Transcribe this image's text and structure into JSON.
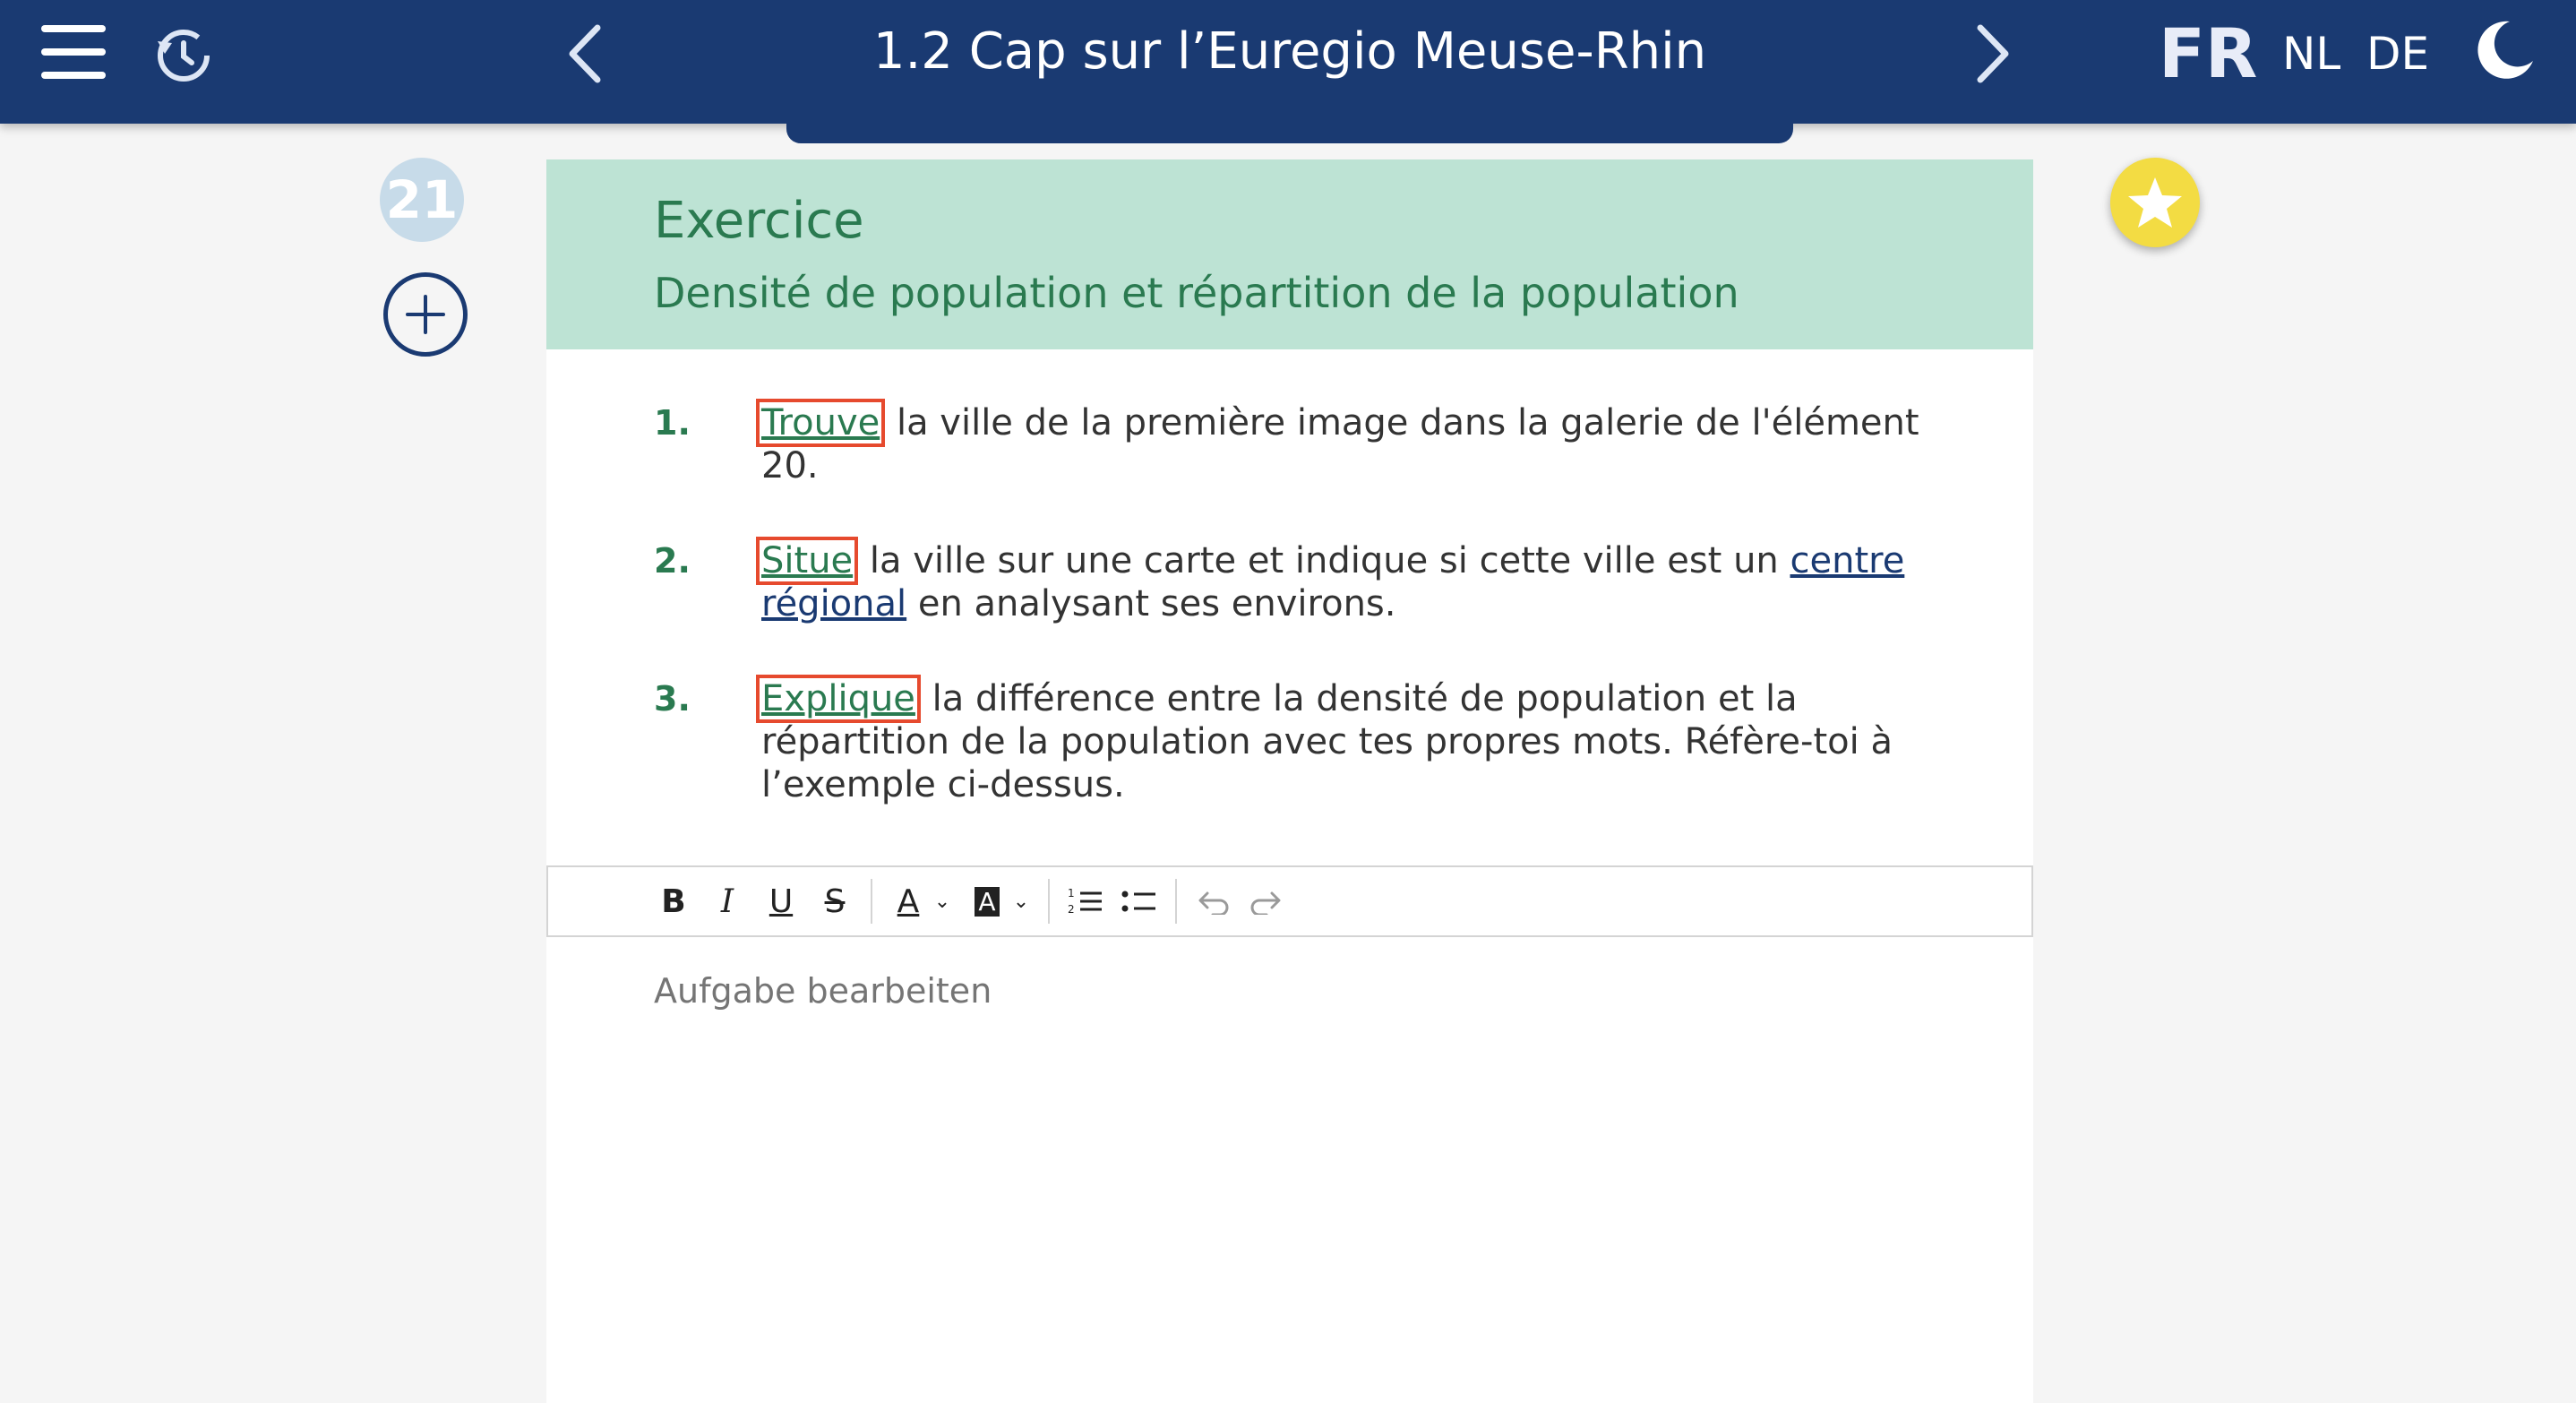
{
  "header": {
    "title": "1.2 Cap sur l’Euregio Meuse-Rhin",
    "languages": [
      "FR",
      "NL",
      "DE"
    ],
    "active_language": "FR",
    "icons": {
      "menu": "hamburger-menu-icon",
      "history": "history-icon",
      "prev": "chevron-left-icon",
      "next": "chevron-right-icon",
      "theme": "moon-icon"
    }
  },
  "sidebar": {
    "element_number": "21",
    "add_icon": "plus-circle-icon"
  },
  "favorite_icon": "star-icon",
  "exercise": {
    "heading": "Exercice",
    "subheading": "Densité de population et répartition de la population",
    "items": [
      {
        "number": "1.",
        "verb": "Trouve",
        "text_before_term": " la ville de la première image dans la galerie de l'élément 20.",
        "term": "",
        "text_after_term": ""
      },
      {
        "number": "2.",
        "verb": "Situe",
        "text_before_term": " la ville sur une carte et indique si cette ville est un ",
        "term": "centre régional",
        "text_after_term": " en analysant ses environs."
      },
      {
        "number": "3.",
        "verb": "Explique",
        "text_before_term": " la différence entre la densité de population et la répartition de la population avec tes propres mots. Réfère-toi à l’exemple ci-dessus.",
        "term": "",
        "text_after_term": ""
      }
    ]
  },
  "editor": {
    "toolbar": {
      "bold": "B",
      "italic": "I",
      "underline": "U",
      "strike": "S",
      "font_color": "A",
      "highlight": "A",
      "ordered_list_icon": "ordered-list-icon",
      "bullet_list_icon": "bullet-list-icon",
      "undo_icon": "undo-icon",
      "redo_icon": "redo-icon"
    },
    "placeholder": "Aufgabe bearbeiten"
  },
  "colors": {
    "header_bg": "#1a3a72",
    "card_head_bg": "#bde3d4",
    "accent_green": "#2a7a50",
    "highlight_box": "#e64a2e",
    "star": "#f3dc43"
  }
}
